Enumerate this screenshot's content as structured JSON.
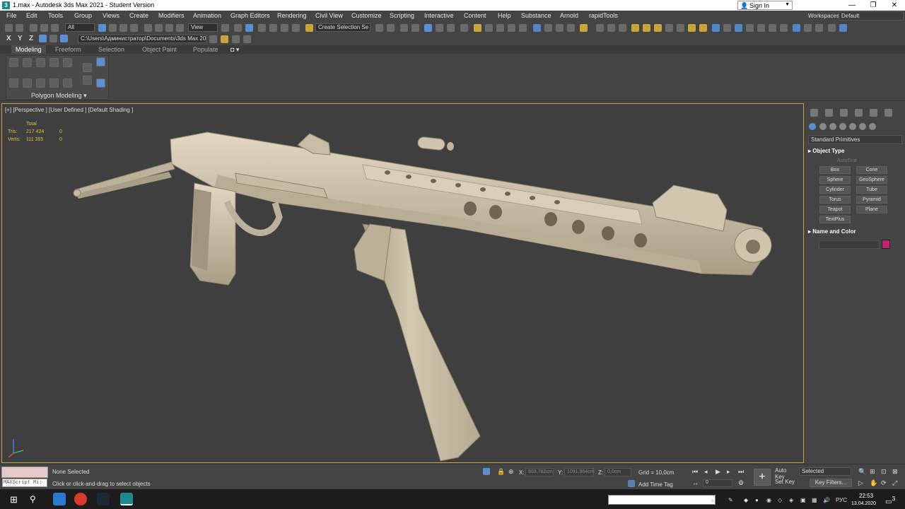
{
  "titlebar": {
    "title": "1.max - Autodesk 3ds Max 2021 - Student Version",
    "icon": "3ds-max-app-icon",
    "minimize": "—",
    "restore": "❐",
    "close": "✕"
  },
  "menubar": {
    "items": [
      "File",
      "Edit",
      "Tools",
      "Group",
      "Views",
      "Create",
      "Modifiers",
      "Animation",
      "Graph Editors",
      "Rendering",
      "Civil View",
      "Customize",
      "Scripting",
      "Interactive",
      "Content",
      "Help",
      "Substance",
      "Arnold",
      "rapidTools"
    ],
    "sign_in": "Sign In",
    "workspaces_label": "Workspaces:",
    "workspace": "Default"
  },
  "toolbar": {
    "selection_filter": "All",
    "ref_coord": "View",
    "named_selection": "Create Selection Se",
    "axis_x": "X",
    "axis_y": "Y",
    "axis_z": "Z",
    "project_path": "C:\\Users\\Администратор\\Documents\\3ds Max 2021"
  },
  "ribbon": {
    "tabs": [
      "Modeling",
      "Freeform",
      "Selection",
      "Object Paint",
      "Populate"
    ],
    "active_tab": "Modeling",
    "panel_label": "Polygon Modeling"
  },
  "viewport": {
    "label": "[+] [Perspective ] [User Defined ] [Default Shading ]",
    "stats_title": "Total",
    "tris_label": "Tris:",
    "tris_value": "217 424",
    "tris_sel": "0",
    "verts_label": "Verts:",
    "verts_value": "111 355",
    "verts_sel": "0",
    "model_colors": {
      "body": "#cbbfa6",
      "shadow": "#9c917b",
      "highlight": "#e2d8c2",
      "background": "#3f3f3f",
      "border": "#c5a244"
    }
  },
  "command_panel": {
    "category": "Standard Primitives",
    "object_type_title": "Object Type",
    "autogrid": "AutoGrid",
    "primitives": [
      "Box",
      "Cone",
      "Sphere",
      "GeoSphere",
      "Cylinder",
      "Tube",
      "Torus",
      "Pyramid",
      "Teapot",
      "Plane",
      "TextPlus"
    ],
    "name_color_title": "Name and Color",
    "object_color": "#c6236f"
  },
  "status": {
    "maxscript_label": "MAXScript Mi:",
    "selection_status": "None Selected",
    "prompt": "Click or click-and-drag to select objects",
    "x_label": "X:",
    "x_value": "903,782cm",
    "y_label": "Y:",
    "y_value": "1091,964cm",
    "z_label": "Z:",
    "z_value": "0,0cm",
    "grid": "Grid = 10,0cm",
    "add_time_tag": "Add Time Tag",
    "auto_key": "Auto Key",
    "selected": "Selected",
    "set_key": "Set Key",
    "key_filters": "Key Filters...",
    "frame": "0"
  },
  "taskbar": {
    "language": "РУС",
    "time": "22:53",
    "date": "13.04.2020",
    "notifications": "3"
  }
}
